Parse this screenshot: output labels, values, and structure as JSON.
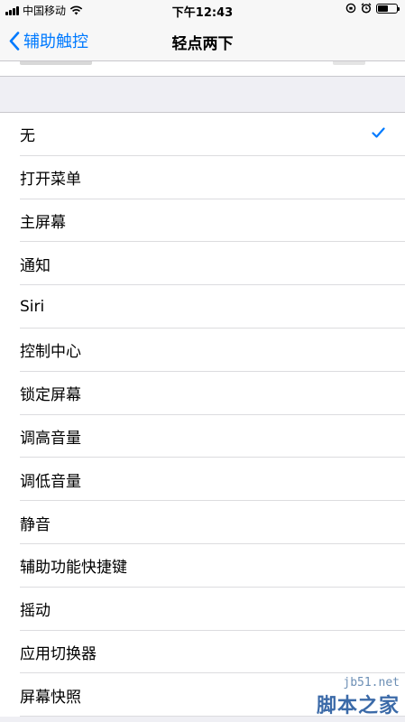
{
  "status_bar": {
    "carrier": "中国移动",
    "time": "下午12:43",
    "battery_level": 0.55
  },
  "nav": {
    "back_label": "辅助触控",
    "title": "轻点两下"
  },
  "list": {
    "items": [
      {
        "label": "无",
        "selected": true
      },
      {
        "label": "打开菜单"
      },
      {
        "label": "主屏幕"
      },
      {
        "label": "通知"
      },
      {
        "label": "Siri"
      },
      {
        "label": "控制中心"
      },
      {
        "label": "锁定屏幕"
      },
      {
        "label": "调高音量"
      },
      {
        "label": "调低音量"
      },
      {
        "label": "静音"
      },
      {
        "label": "辅助功能快捷键"
      },
      {
        "label": "摇动"
      },
      {
        "label": "应用切换器"
      },
      {
        "label": "屏幕快照"
      }
    ]
  },
  "colors": {
    "accent": "#007aff",
    "background": "#efeff4"
  },
  "icons": {
    "back": "chevron-left-icon",
    "check": "checkmark-icon",
    "wifi": "wifi-icon",
    "alarm": "alarm-icon",
    "lock_rotation": "rotation-lock-icon",
    "battery": "battery-icon"
  },
  "watermark": {
    "site": "jb51.net",
    "name": "脚本之家"
  }
}
